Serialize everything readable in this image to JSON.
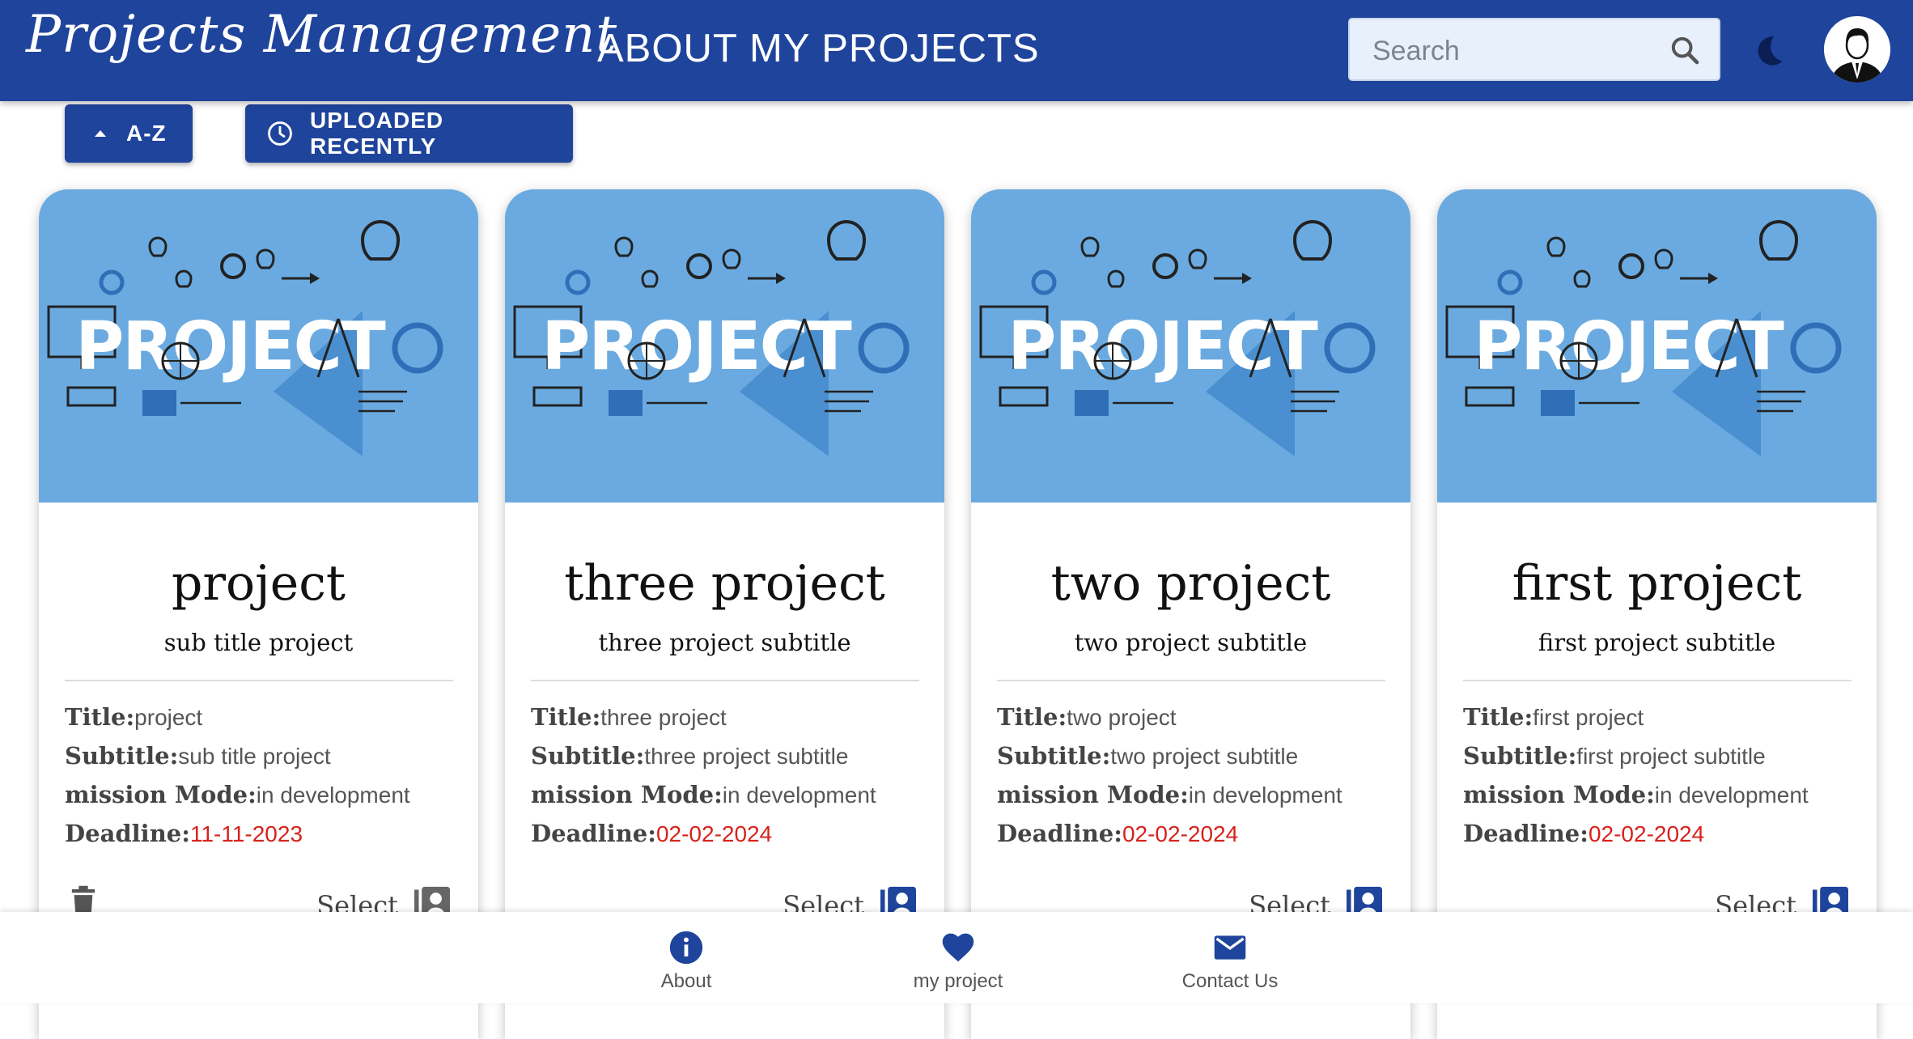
{
  "header": {
    "brand": "Projects Management",
    "nav": {
      "about": "ABOUT",
      "my_projects": "MY PROJECTS"
    },
    "search": {
      "placeholder": "Search",
      "icon": "search-icon"
    },
    "theme_icon": "moon-icon",
    "avatar_icon": "user-avatar"
  },
  "sort": {
    "az_label": "A-Z",
    "recent_label": "UPLOADED RECENTLY"
  },
  "colors": {
    "primary": "#1f449c",
    "card_image_bg": "#6aaae0",
    "deadline": "#d7221b"
  },
  "cards": [
    {
      "title": "project",
      "subtitle": "sub title project",
      "labels": {
        "title": "Title:",
        "subtitle": "Subtitle:",
        "mode": "mission Mode:",
        "deadline": "Deadline:"
      },
      "values": {
        "title": "project",
        "subtitle": "sub title project",
        "mode": "in development",
        "deadline": "11-11-2023"
      },
      "image_text": "PROJECT",
      "select_label": "Select",
      "show_delete": true
    },
    {
      "title": "three project",
      "subtitle": "three project subtitle",
      "labels": {
        "title": "Title:",
        "subtitle": "Subtitle:",
        "mode": "mission Mode:",
        "deadline": "Deadline:"
      },
      "values": {
        "title": "three project",
        "subtitle": "three project subtitle",
        "mode": "in development",
        "deadline": "02-02-2024"
      },
      "image_text": "PROJECT",
      "select_label": "Select",
      "show_delete": false
    },
    {
      "title": "two project",
      "subtitle": "two project subtitle",
      "labels": {
        "title": "Title:",
        "subtitle": "Subtitle:",
        "mode": "mission Mode:",
        "deadline": "Deadline:"
      },
      "values": {
        "title": "two project",
        "subtitle": "two project subtitle",
        "mode": "in development",
        "deadline": "02-02-2024"
      },
      "image_text": "PROJECT",
      "select_label": "Select",
      "show_delete": false
    },
    {
      "title": "first project",
      "subtitle": "first project subtitle",
      "labels": {
        "title": "Title:",
        "subtitle": "Subtitle:",
        "mode": "mission Mode:",
        "deadline": "Deadline:"
      },
      "values": {
        "title": "first project",
        "subtitle": "first project subtitle",
        "mode": "in development",
        "deadline": "02-02-2024"
      },
      "image_text": "PROJECT",
      "select_label": "Select",
      "show_delete": false
    }
  ],
  "bottom_nav": [
    {
      "label": "About",
      "icon": "info-icon"
    },
    {
      "label": "my project",
      "icon": "heart-icon"
    },
    {
      "label": "Contact Us",
      "icon": "mail-icon"
    }
  ]
}
